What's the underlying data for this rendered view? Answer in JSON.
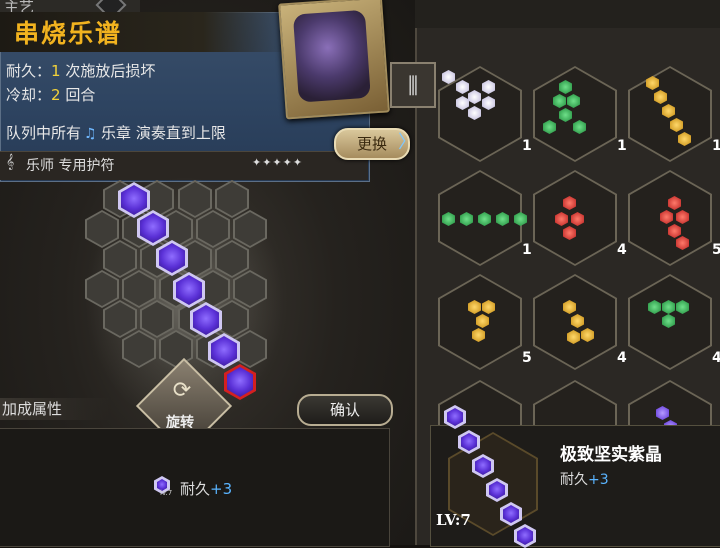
{
  "top_tab": {
    "label": "主艺"
  },
  "charm": {
    "name": "串烧乐谱",
    "durability_label": "耐久：",
    "durability_value": "1",
    "durability_suffix": "次施放后损坏",
    "cooldown_label": "冷却：",
    "cooldown_value": "2",
    "cooldown_suffix": "回合",
    "effect_prefix": "队列中所有",
    "effect_keyword": "乐章",
    "effect_suffix": "演奏直到上限",
    "class_label": "乐师 专用护符",
    "rarity_text": "✦✦✦✦✦",
    "replace_label": "更换"
  },
  "board": {
    "rotate_label": "旋转",
    "confirm_label": "确认"
  },
  "bonus": {
    "title": "加成属性",
    "gem_level": "lv.7",
    "stat_label": "耐久",
    "stat_value": "+3"
  },
  "inventory": {
    "filter_icon": "filter-icon",
    "slots": [
      {
        "count": "1",
        "color": "white"
      },
      {
        "count": "1",
        "color": "green"
      },
      {
        "count": "1",
        "color": "yellow"
      },
      {
        "count": "1",
        "color": "green"
      },
      {
        "count": "4",
        "color": "red"
      },
      {
        "count": "5",
        "color": "red"
      },
      {
        "count": "5",
        "color": "yellow"
      },
      {
        "count": "4",
        "color": "yellow"
      },
      {
        "count": "4",
        "color": "green"
      }
    ]
  },
  "tooltip": {
    "name": "极致坚实紫晶",
    "stat_label": "耐久",
    "stat_value": "+3",
    "level": "LV:7"
  }
}
